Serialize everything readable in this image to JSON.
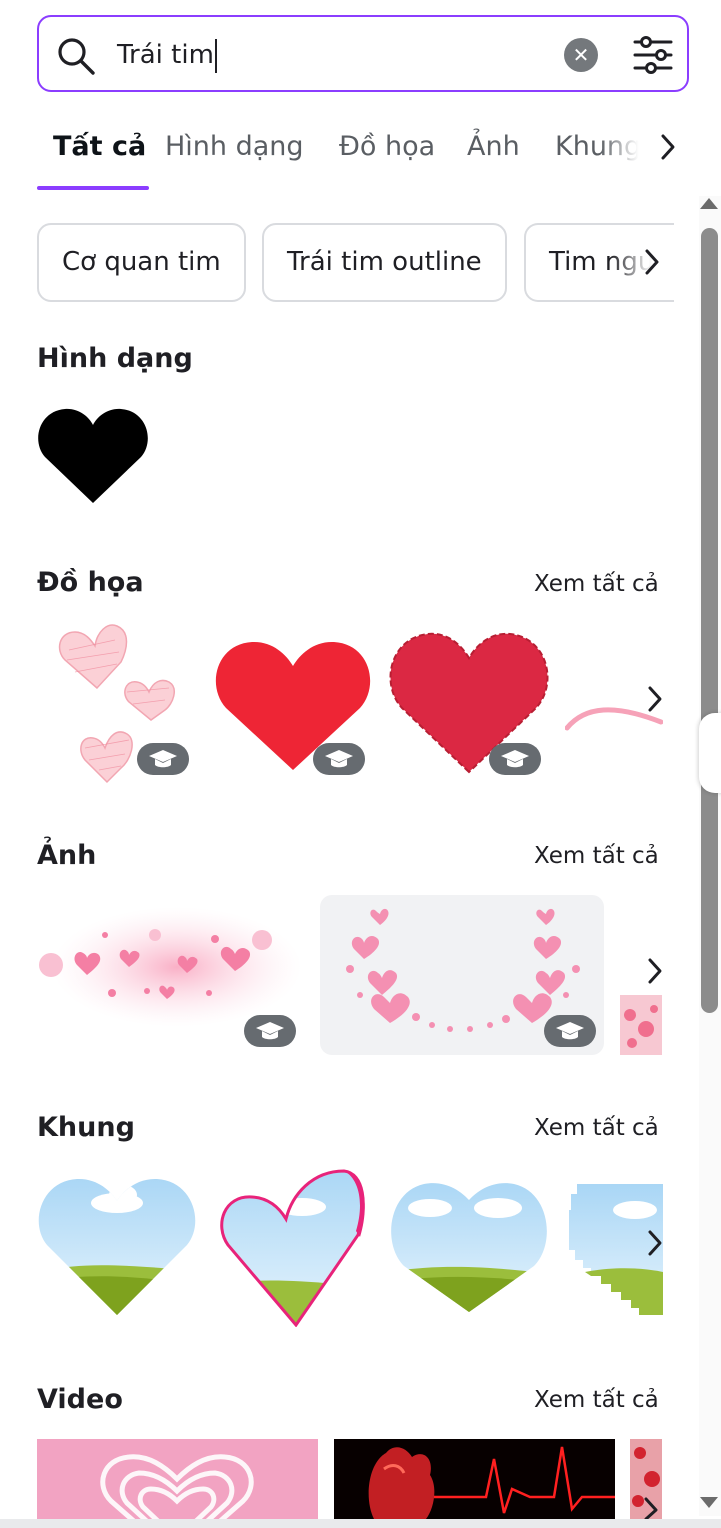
{
  "search": {
    "value": "Trái tim",
    "clear_icon": "clear-x-icon",
    "filter_icon": "filter-sliders-icon",
    "search_icon": "search-icon",
    "border_color": "#8b3dff"
  },
  "tabs": [
    "Tất cả",
    "Hình dạng",
    "Đồ họa",
    "Ảnh",
    "Khung"
  ],
  "active_tab": "Tất cả",
  "chips": [
    "Cơ quan tim",
    "Trái tim outline",
    "Tim ngu"
  ],
  "sections": {
    "shapes": {
      "title": "Hình dạng"
    },
    "graphics": {
      "title": "Đồ họa",
      "see_all": "Xem tất cả"
    },
    "photos": {
      "title": "Ảnh",
      "see_all": "Xem tất cả"
    },
    "frames": {
      "title": "Khung",
      "see_all": "Xem tất cả"
    },
    "videos": {
      "title": "Video",
      "see_all": "Xem tất cả"
    }
  },
  "colors": {
    "accent": "#8b3dff",
    "heart_red": "#ee2535",
    "heart_dark_red": "#db2843",
    "pink": "#f9a7bd",
    "sky": "#cde9fb",
    "grass": "#86a82a"
  }
}
